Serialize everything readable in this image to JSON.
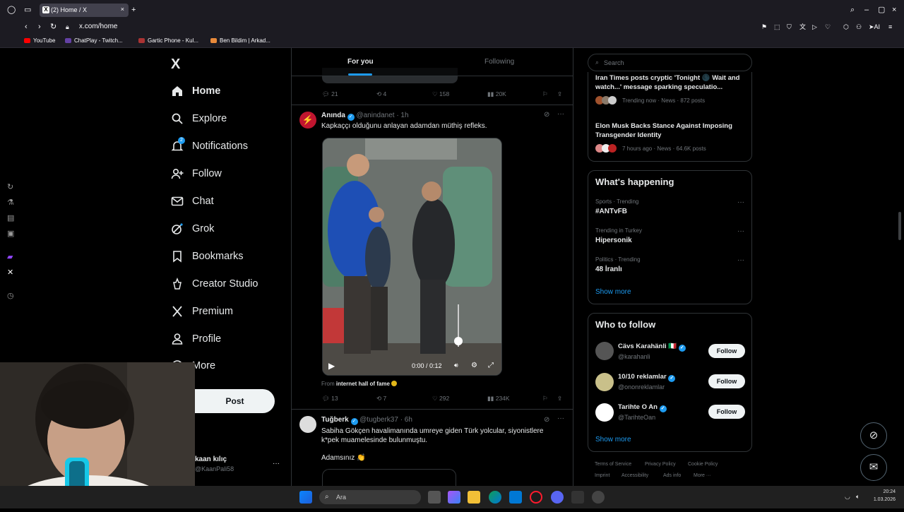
{
  "browser": {
    "tab_title": "(2) Home / X",
    "url": "x.com/home",
    "bookmarks": [
      "YouTube",
      "ChatPlay - Twitch...",
      "Gartic Phone - Kul...",
      "Ben Bildim | Arkad..."
    ],
    "ai_label": "AI"
  },
  "nav": {
    "logo": "X",
    "items": [
      "Home",
      "Explore",
      "Notifications",
      "Follow",
      "Chat",
      "Grok",
      "Bookmarks",
      "Creator Studio",
      "Premium",
      "Profile",
      "More"
    ],
    "notif_count": "2",
    "post_label": "Post",
    "account_name": "kaan kılıç",
    "account_handle": "@KaanPali58",
    "account_more": "···"
  },
  "timeline": {
    "tabs": [
      "For you",
      "Following"
    ],
    "prev_tweet_actions": {
      "replies": "21",
      "reposts": "4",
      "likes": "158",
      "views": "20K"
    },
    "tweet1": {
      "name": "Anında",
      "handle": "@anindanet",
      "time": "· 1h",
      "text": "Kapkaççı olduğunu anlayan adamdan müthiş refleks.",
      "video_time": "0:00 / 0:12",
      "from_label": "From",
      "from_source": "internet hall of fame",
      "replies": "13",
      "reposts": "7",
      "likes": "292",
      "views": "234K"
    },
    "tweet2": {
      "name": "Tuğberk",
      "handle": "@tugberk37",
      "time": "· 6h",
      "text": "Sabiha Gökçen havalimanında umreye giden Türk yolcular, siyonistlere k*pek muamelesinde bulunmuştu.",
      "text2": "Adamsınız 👏"
    }
  },
  "sidebar": {
    "search_placeholder": "Search",
    "news": [
      {
        "title": "Iran Times posts cryptic 'Tonight 🌑 Wait and watch...' message sparking speculatio...",
        "meta": "Trending now · News · 872 posts"
      },
      {
        "title": "Elon Musk Backs Stance Against Imposing Transgender Identity",
        "meta": "7 hours ago · News · 64.6K posts"
      }
    ],
    "happening_title": "What's happening",
    "trends": [
      {
        "meta": "Sports · Trending",
        "name": "#ANTvFB"
      },
      {
        "meta": "Trending in Turkey",
        "name": "Hipersonik"
      },
      {
        "meta": "Politics · Trending",
        "name": "48 İranlı"
      }
    ],
    "show_more": "Show more",
    "wtf_title": "Who to follow",
    "wtf": [
      {
        "name": "Cävs Karahänli 🇮🇹",
        "handle": "@karahanli",
        "button": "Follow"
      },
      {
        "name": "10/10 reklamlar",
        "handle": "@ononreklamlar",
        "button": "Follow"
      },
      {
        "name": "Tarihte O An",
        "handle": "@TarihteOan",
        "button": "Follow"
      }
    ],
    "footer": [
      "Terms of Service",
      "Privacy Policy",
      "Cookie Policy",
      "Imprint",
      "Accessibility",
      "Ads info",
      "More ···"
    ]
  },
  "taskbar": {
    "search_label": "Ara",
    "clock_time": "20:24",
    "clock_date": "1.03.2026"
  },
  "colors": {
    "accent": "#1d9bf0",
    "bg": "#000000",
    "border": "#2f3336"
  }
}
